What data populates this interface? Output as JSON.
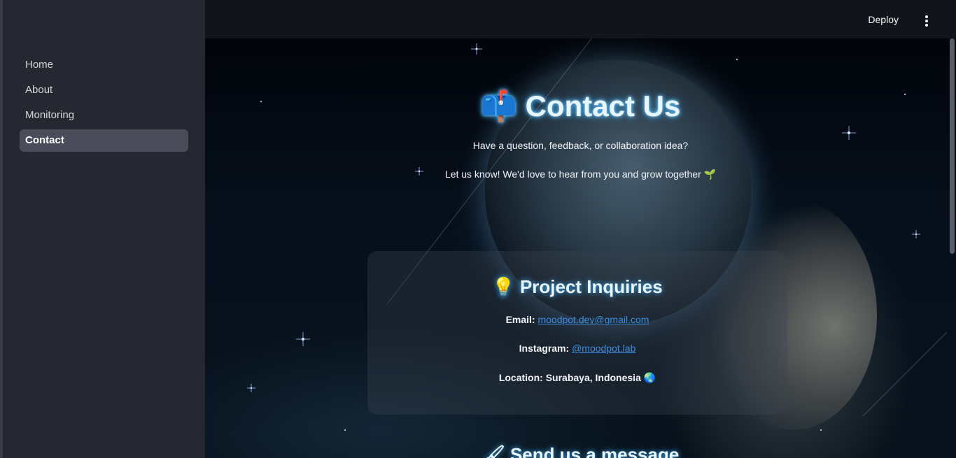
{
  "sidebar": {
    "items": [
      {
        "label": "Home",
        "active": false
      },
      {
        "label": "About",
        "active": false
      },
      {
        "label": "Monitoring",
        "active": false
      },
      {
        "label": "Contact",
        "active": true
      }
    ]
  },
  "header": {
    "deploy_label": "Deploy",
    "menu_icon": "kebab-menu-icon"
  },
  "main": {
    "title_emoji": "📫",
    "title": "Contact Us",
    "tagline_1": "Have a question, feedback, or collaboration idea?",
    "tagline_2": "Let us know! We'd love to hear from you and grow together 🌱",
    "card": {
      "emoji": "💡",
      "title": "Project Inquiries",
      "email_label": "Email:",
      "email": "moodpot.dev@gmail.com",
      "instagram_label": "Instagram:",
      "instagram": "@moodpot.lab",
      "location_label": "Location: Surabaya, Indonesia",
      "location_emoji": "🌏"
    },
    "section2_emoji": "🖌",
    "section2_title": "Send us a message"
  },
  "colors": {
    "sidebar_bg": "#262730",
    "header_bg": "#12141c",
    "accent_glow": "#3fb3ff",
    "link": "#3d8fe0"
  }
}
